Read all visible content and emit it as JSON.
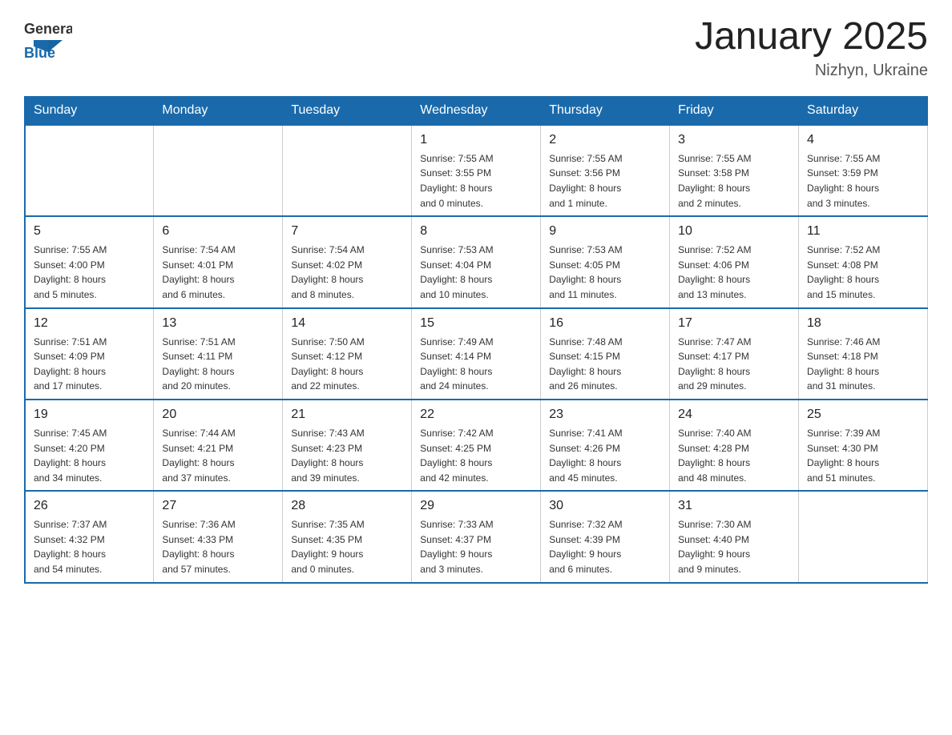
{
  "header": {
    "logo": {
      "general": "General",
      "blue": "Blue"
    },
    "title": "January 2025",
    "subtitle": "Nizhyn, Ukraine"
  },
  "weekdays": [
    "Sunday",
    "Monday",
    "Tuesday",
    "Wednesday",
    "Thursday",
    "Friday",
    "Saturday"
  ],
  "weeks": [
    [
      {
        "day": "",
        "info": ""
      },
      {
        "day": "",
        "info": ""
      },
      {
        "day": "",
        "info": ""
      },
      {
        "day": "1",
        "info": "Sunrise: 7:55 AM\nSunset: 3:55 PM\nDaylight: 8 hours\nand 0 minutes."
      },
      {
        "day": "2",
        "info": "Sunrise: 7:55 AM\nSunset: 3:56 PM\nDaylight: 8 hours\nand 1 minute."
      },
      {
        "day": "3",
        "info": "Sunrise: 7:55 AM\nSunset: 3:58 PM\nDaylight: 8 hours\nand 2 minutes."
      },
      {
        "day": "4",
        "info": "Sunrise: 7:55 AM\nSunset: 3:59 PM\nDaylight: 8 hours\nand 3 minutes."
      }
    ],
    [
      {
        "day": "5",
        "info": "Sunrise: 7:55 AM\nSunset: 4:00 PM\nDaylight: 8 hours\nand 5 minutes."
      },
      {
        "day": "6",
        "info": "Sunrise: 7:54 AM\nSunset: 4:01 PM\nDaylight: 8 hours\nand 6 minutes."
      },
      {
        "day": "7",
        "info": "Sunrise: 7:54 AM\nSunset: 4:02 PM\nDaylight: 8 hours\nand 8 minutes."
      },
      {
        "day": "8",
        "info": "Sunrise: 7:53 AM\nSunset: 4:04 PM\nDaylight: 8 hours\nand 10 minutes."
      },
      {
        "day": "9",
        "info": "Sunrise: 7:53 AM\nSunset: 4:05 PM\nDaylight: 8 hours\nand 11 minutes."
      },
      {
        "day": "10",
        "info": "Sunrise: 7:52 AM\nSunset: 4:06 PM\nDaylight: 8 hours\nand 13 minutes."
      },
      {
        "day": "11",
        "info": "Sunrise: 7:52 AM\nSunset: 4:08 PM\nDaylight: 8 hours\nand 15 minutes."
      }
    ],
    [
      {
        "day": "12",
        "info": "Sunrise: 7:51 AM\nSunset: 4:09 PM\nDaylight: 8 hours\nand 17 minutes."
      },
      {
        "day": "13",
        "info": "Sunrise: 7:51 AM\nSunset: 4:11 PM\nDaylight: 8 hours\nand 20 minutes."
      },
      {
        "day": "14",
        "info": "Sunrise: 7:50 AM\nSunset: 4:12 PM\nDaylight: 8 hours\nand 22 minutes."
      },
      {
        "day": "15",
        "info": "Sunrise: 7:49 AM\nSunset: 4:14 PM\nDaylight: 8 hours\nand 24 minutes."
      },
      {
        "day": "16",
        "info": "Sunrise: 7:48 AM\nSunset: 4:15 PM\nDaylight: 8 hours\nand 26 minutes."
      },
      {
        "day": "17",
        "info": "Sunrise: 7:47 AM\nSunset: 4:17 PM\nDaylight: 8 hours\nand 29 minutes."
      },
      {
        "day": "18",
        "info": "Sunrise: 7:46 AM\nSunset: 4:18 PM\nDaylight: 8 hours\nand 31 minutes."
      }
    ],
    [
      {
        "day": "19",
        "info": "Sunrise: 7:45 AM\nSunset: 4:20 PM\nDaylight: 8 hours\nand 34 minutes."
      },
      {
        "day": "20",
        "info": "Sunrise: 7:44 AM\nSunset: 4:21 PM\nDaylight: 8 hours\nand 37 minutes."
      },
      {
        "day": "21",
        "info": "Sunrise: 7:43 AM\nSunset: 4:23 PM\nDaylight: 8 hours\nand 39 minutes."
      },
      {
        "day": "22",
        "info": "Sunrise: 7:42 AM\nSunset: 4:25 PM\nDaylight: 8 hours\nand 42 minutes."
      },
      {
        "day": "23",
        "info": "Sunrise: 7:41 AM\nSunset: 4:26 PM\nDaylight: 8 hours\nand 45 minutes."
      },
      {
        "day": "24",
        "info": "Sunrise: 7:40 AM\nSunset: 4:28 PM\nDaylight: 8 hours\nand 48 minutes."
      },
      {
        "day": "25",
        "info": "Sunrise: 7:39 AM\nSunset: 4:30 PM\nDaylight: 8 hours\nand 51 minutes."
      }
    ],
    [
      {
        "day": "26",
        "info": "Sunrise: 7:37 AM\nSunset: 4:32 PM\nDaylight: 8 hours\nand 54 minutes."
      },
      {
        "day": "27",
        "info": "Sunrise: 7:36 AM\nSunset: 4:33 PM\nDaylight: 8 hours\nand 57 minutes."
      },
      {
        "day": "28",
        "info": "Sunrise: 7:35 AM\nSunset: 4:35 PM\nDaylight: 9 hours\nand 0 minutes."
      },
      {
        "day": "29",
        "info": "Sunrise: 7:33 AM\nSunset: 4:37 PM\nDaylight: 9 hours\nand 3 minutes."
      },
      {
        "day": "30",
        "info": "Sunrise: 7:32 AM\nSunset: 4:39 PM\nDaylight: 9 hours\nand 6 minutes."
      },
      {
        "day": "31",
        "info": "Sunrise: 7:30 AM\nSunset: 4:40 PM\nDaylight: 9 hours\nand 9 minutes."
      },
      {
        "day": "",
        "info": ""
      }
    ]
  ]
}
